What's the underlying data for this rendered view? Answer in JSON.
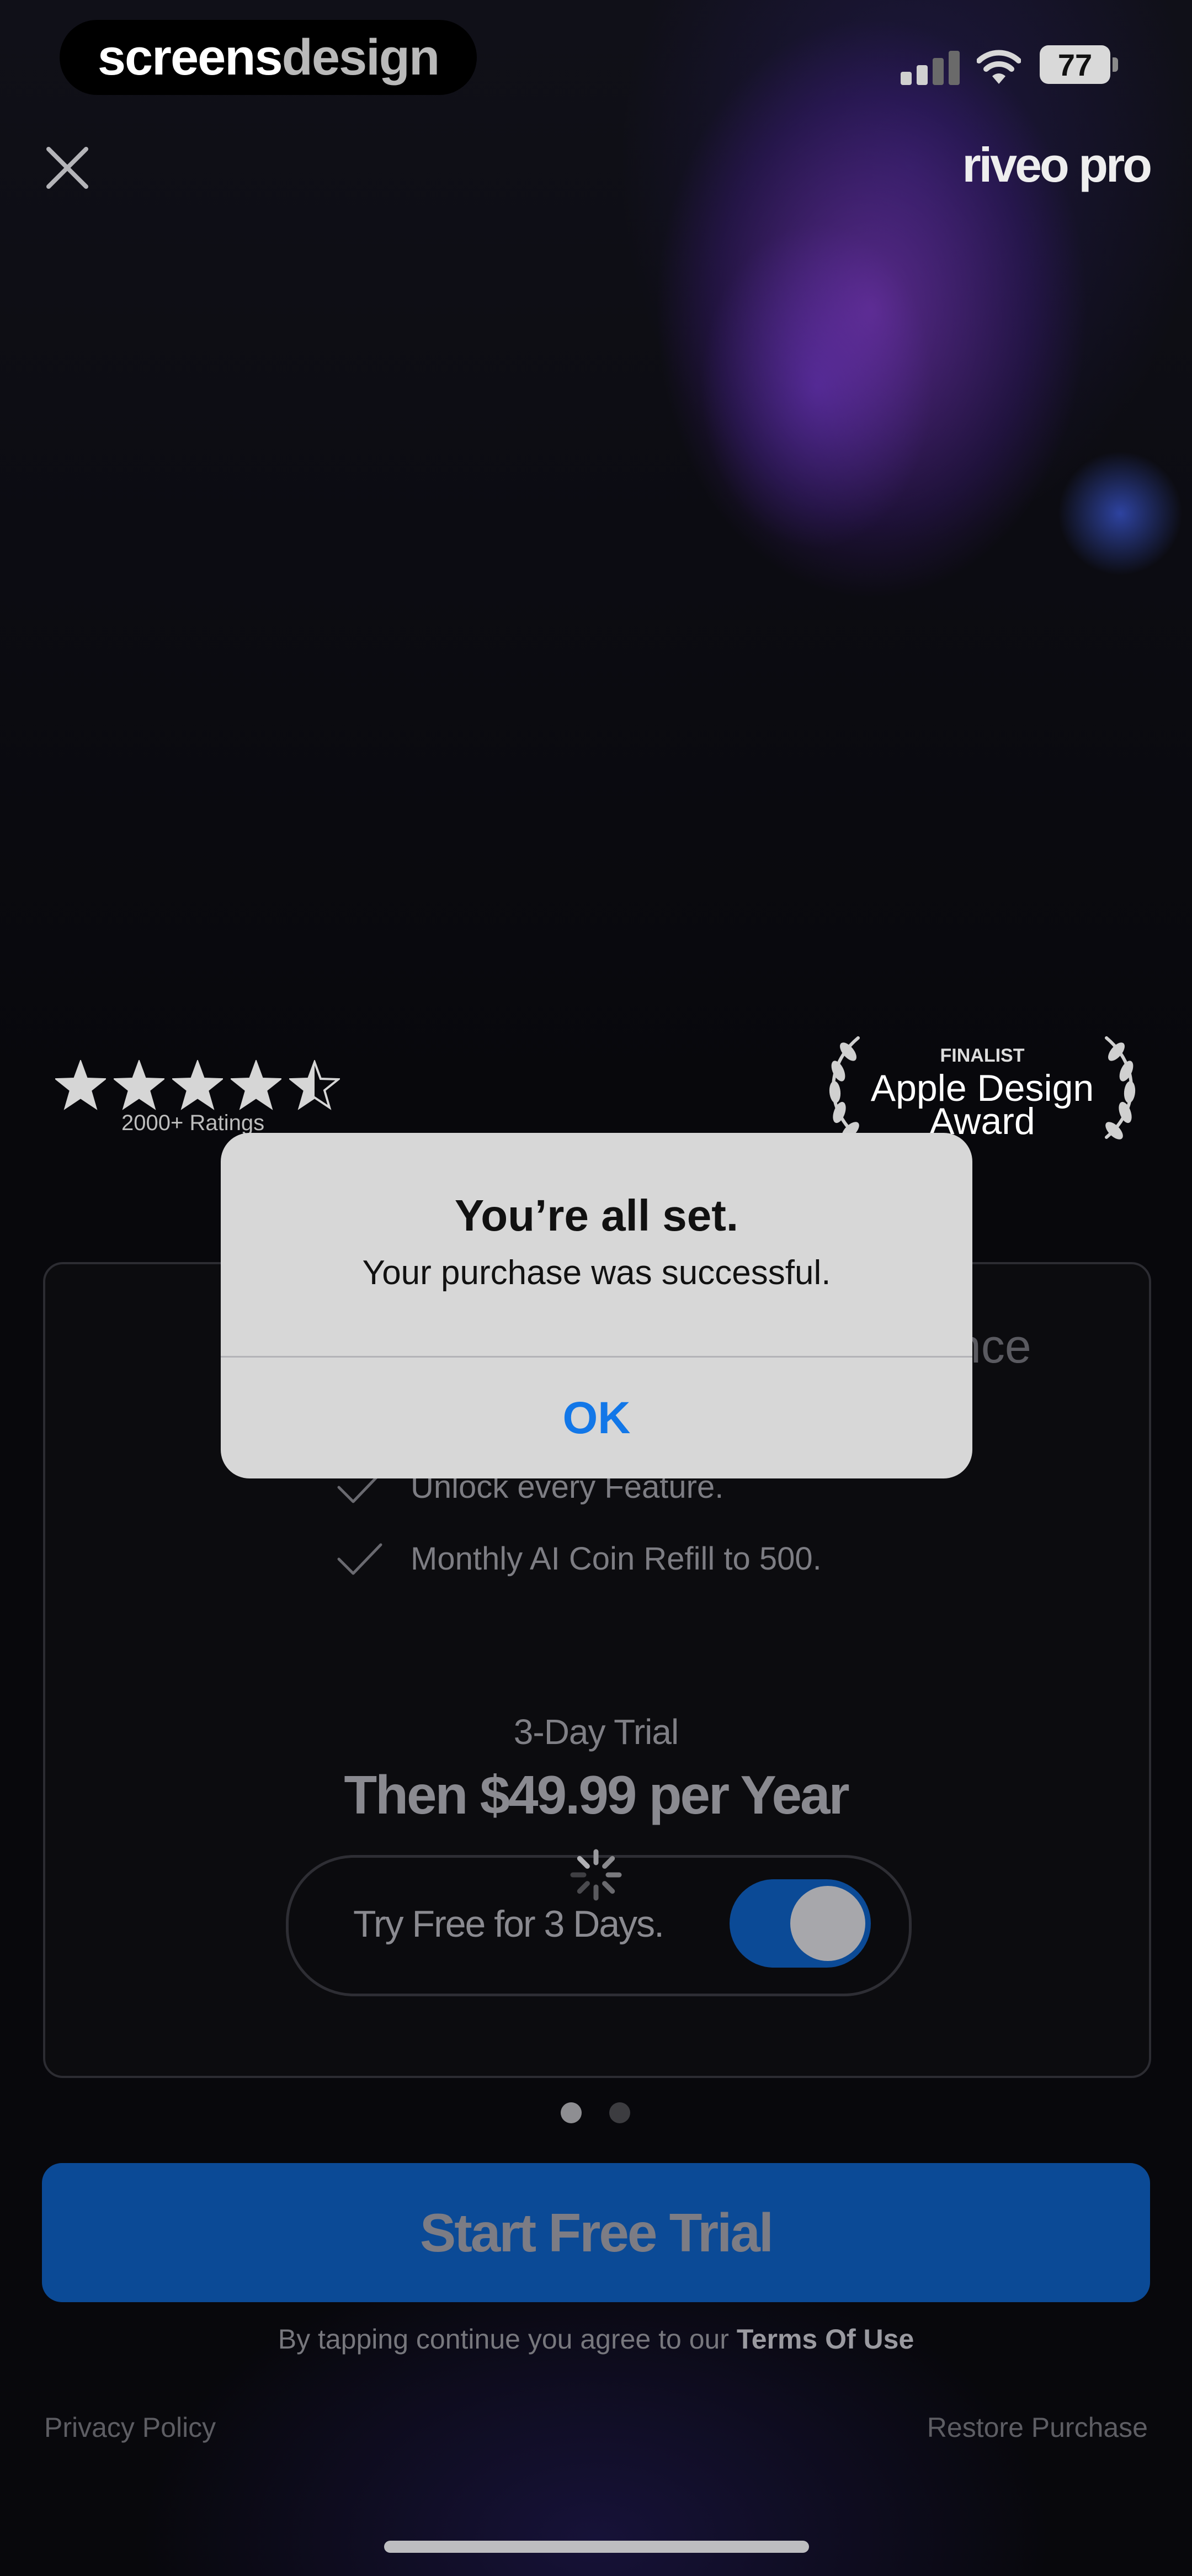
{
  "status_bar": {
    "brand_part1": "screens",
    "brand_part2": "design",
    "battery": "77"
  },
  "header": {
    "app_logo": "riveo pro"
  },
  "rating": {
    "stars": 4.5,
    "label": "2000+ Ratings"
  },
  "award": {
    "small": "FINALIST",
    "line1": "Apple Design",
    "line2": "Award"
  },
  "plan_card": {
    "faded_text": "nce",
    "features": [
      "Unlock every Feature.",
      "Monthly AI Coin Refill to 500."
    ],
    "trial_label": "3-Day Trial",
    "price": "Then $49.99 per Year",
    "toggle_label": "Try Free for 3 Days.",
    "toggle_on": true
  },
  "pagination": {
    "count": 2,
    "active": 0
  },
  "cta": {
    "label": "Start Free Trial"
  },
  "footer": {
    "terms_prefix": "By tapping continue you agree to our ",
    "terms_link": "Terms Of Use",
    "privacy": "Privacy Policy",
    "restore": "Restore Purchase"
  },
  "alert": {
    "title": "You’re all set.",
    "message": "Your purchase was successful.",
    "ok_label": "OK"
  },
  "colors": {
    "accent_blue": "#1277e8",
    "toggle_blue": "#0b4a96"
  }
}
